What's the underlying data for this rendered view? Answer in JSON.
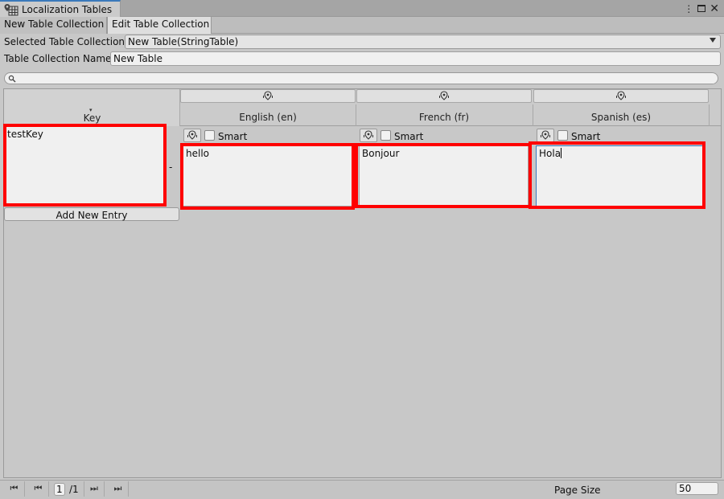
{
  "window": {
    "title": "Localization Tables",
    "icon": "localization-table-icon"
  },
  "tabs": [
    {
      "label": "New Table Collection",
      "active": false
    },
    {
      "label": "Edit Table Collection",
      "active": true
    }
  ],
  "form": {
    "selected_label": "Selected Table Collection",
    "selected_value": "New Table(StringTable)",
    "name_label": "Table Collection Name",
    "name_value": "New Table"
  },
  "search": {
    "placeholder": "",
    "icon": "search-icon"
  },
  "table": {
    "key_header": "Key",
    "columns": [
      {
        "label": "English (en)",
        "smart_label": "Smart"
      },
      {
        "label": "French (fr)",
        "smart_label": "Smart"
      },
      {
        "label": "Spanish (es)",
        "smart_label": "Smart"
      }
    ],
    "rows": [
      {
        "key": "testKey",
        "remove_label": "-",
        "values": [
          "hello",
          "Bonjour",
          "Hola"
        ]
      }
    ],
    "add_entry_label": "Add New Entry"
  },
  "pagination": {
    "current_page": "1",
    "total_pages": "/1",
    "page_size_label": "Page Size",
    "page_size_value": "50"
  },
  "colors": {
    "highlight": "#ff0000",
    "active_tab_accent": "#3a79bb"
  }
}
